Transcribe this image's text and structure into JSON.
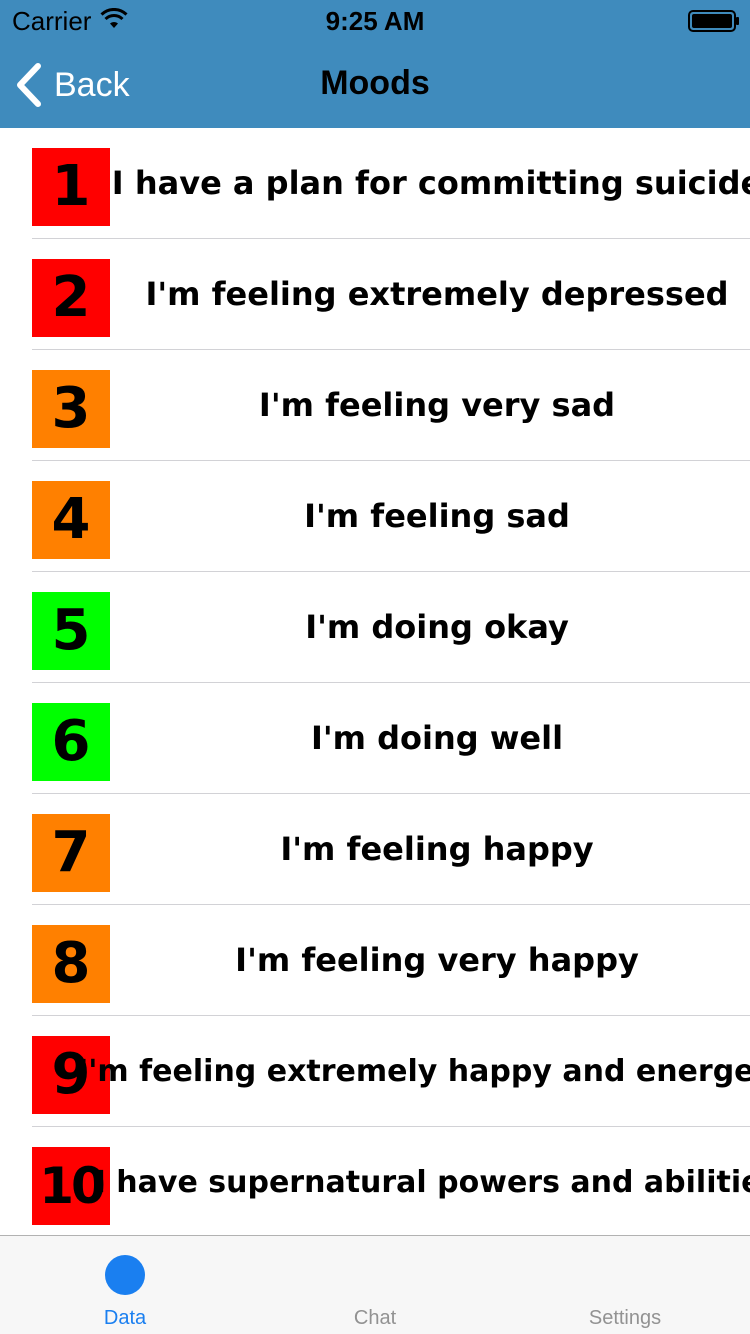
{
  "status_bar": {
    "carrier": "Carrier",
    "time": "9:25 AM"
  },
  "nav": {
    "back_label": "Back",
    "title": "Moods"
  },
  "colors": {
    "nav_background": "#3f8bbd",
    "red": "#ff0000",
    "orange": "#ff8000",
    "green": "#00ff00",
    "tab_active": "#1a7ff0",
    "tab_inactive": "#929292"
  },
  "moods": [
    {
      "number": "1",
      "label": "I have a plan for committing suicide",
      "color": "#ff0000"
    },
    {
      "number": "2",
      "label": "I'm feeling extremely depressed",
      "color": "#ff0000"
    },
    {
      "number": "3",
      "label": "I'm feeling very sad",
      "color": "#ff8000"
    },
    {
      "number": "4",
      "label": "I'm feeling sad",
      "color": "#ff8000"
    },
    {
      "number": "5",
      "label": "I'm doing okay",
      "color": "#00ff00"
    },
    {
      "number": "6",
      "label": "I'm doing well",
      "color": "#00ff00"
    },
    {
      "number": "7",
      "label": "I'm feeling happy",
      "color": "#ff8000"
    },
    {
      "number": "8",
      "label": "I'm feeling very happy",
      "color": "#ff8000"
    },
    {
      "number": "9",
      "label": "I'm feeling extremely happy and energetic",
      "color": "#ff0000"
    },
    {
      "number": "10",
      "label": "I have supernatural powers and abilities",
      "color": "#ff0000"
    }
  ],
  "tabs": [
    {
      "label": "Data",
      "active": true,
      "icon": "circle-icon"
    },
    {
      "label": "Chat",
      "active": false,
      "icon": "none"
    },
    {
      "label": "Settings",
      "active": false,
      "icon": "none"
    }
  ]
}
